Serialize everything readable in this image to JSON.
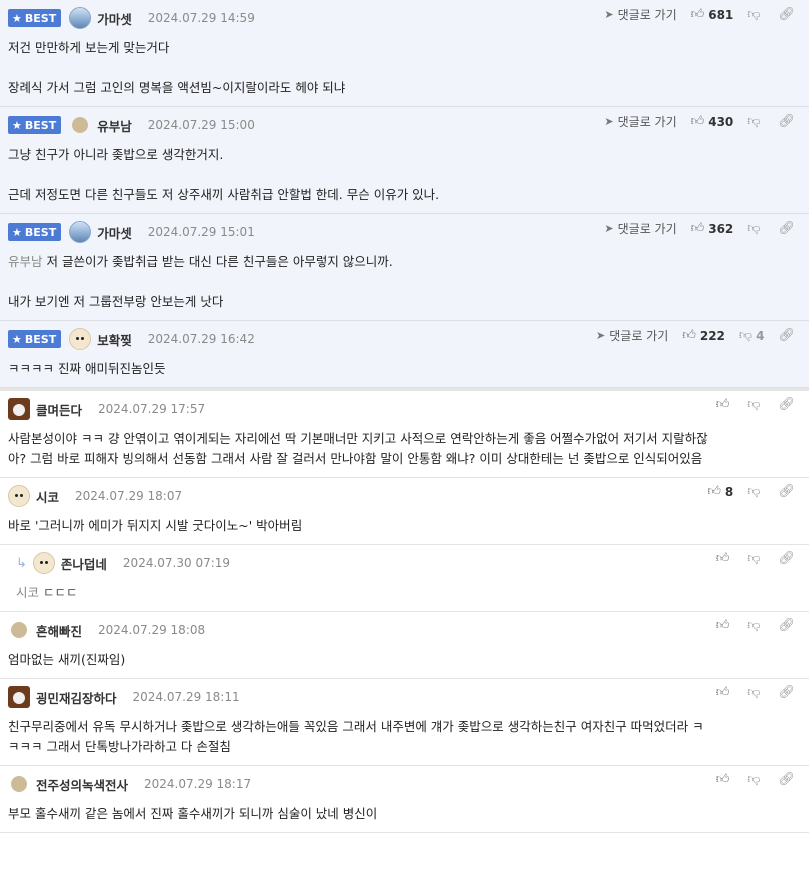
{
  "labels": {
    "best": "BEST",
    "reply_goto": "댓글로 가기"
  },
  "best_comments": [
    {
      "nick": "가마셋",
      "avatar": "blue",
      "date": "2024.07.29 14:59",
      "likes": "681",
      "downs": "",
      "lines": [
        "저건 만만하게 보는게 맞는거다",
        "",
        "장례식 가서 그럼 고인의 명복을 액션빔~이지랄이라도 헤야 되냐"
      ]
    },
    {
      "nick": "유부남",
      "avatar": "dot",
      "date": "2024.07.29 15:00",
      "likes": "430",
      "downs": "",
      "lines": [
        "그냥 친구가 아니라 좆밥으로 생각한거지.",
        "",
        "근데 저정도면 다른 친구들도 저 상주새끼 사람취급 안할법 한데. 무슨 이유가 있나."
      ]
    },
    {
      "nick": "가마셋",
      "avatar": "blue",
      "date": "2024.07.29 15:01",
      "likes": "362",
      "downs": "",
      "mention": "유부남",
      "lines": [
        "저 글쓴이가 좆밥취급 받는 대신 다른 친구들은 아무렇지 않으니까.",
        "",
        "내가 보기엔 저 그룹전부랑 안보는게 낫다"
      ]
    },
    {
      "nick": "보확찢",
      "avatar": "pup",
      "date": "2024.07.29 16:42",
      "likes": "222",
      "downs": "4",
      "lines": [
        "ㅋㅋㅋㅋ 진짜 애미뒤진놈인듯"
      ]
    }
  ],
  "comments": [
    {
      "nick": "클며든다",
      "avatar": "bear",
      "date": "2024.07.29 17:57",
      "likes": "",
      "reply": false,
      "lines": [
        "사람본성이야 ㅋㅋ 걍 안엮이고 엮이게되는 자리에선 딱 기본매너만 지키고 사적으로 연락안하는게 좋음 어쩔수가없어 저기서 지랄하잖",
        "아? 그럼 바로 피해자 빙의해서 선동함 그래서 사람 잘 걸러서 만나야함 말이 안통함 왜냐? 이미 상대한테는 넌 좆밥으로 인식되어있음"
      ]
    },
    {
      "nick": "시코",
      "avatar": "pup",
      "date": "2024.07.29 18:07",
      "likes": "8",
      "reply": false,
      "lines": [
        "바로 '그러니까 에미가 뒤지지 시발 굿다이노~' 박아버림"
      ]
    },
    {
      "nick": "존나덥네",
      "avatar": "pup",
      "date": "2024.07.30 07:19",
      "likes": "",
      "reply": true,
      "mention": "시코",
      "lines": [
        "ㄷㄷㄷ"
      ]
    },
    {
      "nick": "흔해빠진",
      "avatar": "dot",
      "date": "2024.07.29 18:08",
      "likes": "",
      "reply": false,
      "lines": [
        "엄마없는 새끼(진짜임)"
      ]
    },
    {
      "nick": "굉민재김장하다",
      "avatar": "bear",
      "date": "2024.07.29 18:11",
      "likes": "",
      "reply": false,
      "lines": [
        "친구무리중에서 유독 무시하거나 좆밥으로 생각하는애들 꼭있음 그래서 내주변에 걔가 좆밥으로 생각하는친구 여자친구 따먹었더라 ㅋ",
        "ㅋㅋㅋ 그래서 단톡방나가라하고 다 손절침"
      ]
    },
    {
      "nick": "전주성의녹색전사",
      "avatar": "dot",
      "date": "2024.07.29 18:17",
      "likes": "",
      "reply": false,
      "lines": [
        "부모 홀수새끼 같은 놈에서 진짜 홀수새끼가 되니까 심술이 났네 병신이"
      ]
    }
  ]
}
